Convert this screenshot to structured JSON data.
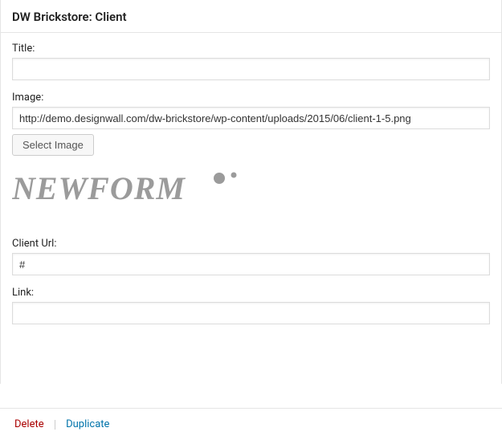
{
  "header": {
    "title": "DW Brickstore: Client"
  },
  "fields": {
    "title": {
      "label": "Title:",
      "value": ""
    },
    "image": {
      "label": "Image:",
      "value": "http://demo.designwall.com/dw-brickstore/wp-content/uploads/2015/06/client-1-5.png",
      "button": "Select Image",
      "preview_text": "NEWFORM"
    },
    "client_url": {
      "label": "Client Url:",
      "value": "#"
    },
    "link": {
      "label": "Link:",
      "value": ""
    }
  },
  "footer": {
    "delete": "Delete",
    "duplicate": "Duplicate"
  }
}
